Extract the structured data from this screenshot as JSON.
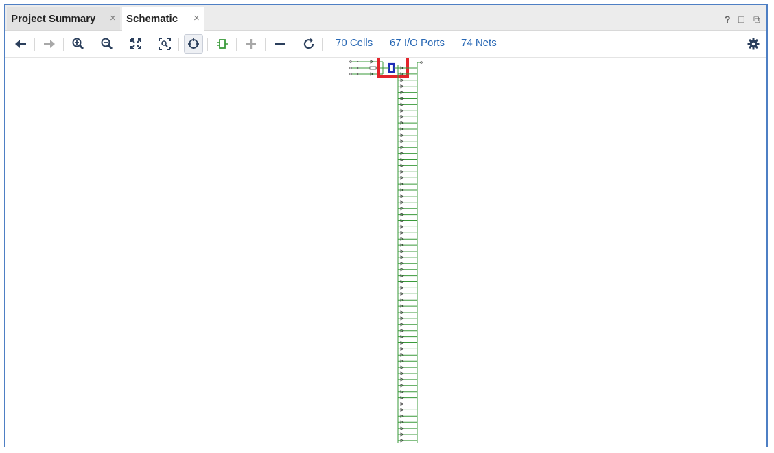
{
  "tabs": [
    {
      "label": "Project Summary",
      "active": false
    },
    {
      "label": "Schematic",
      "active": true
    }
  ],
  "tab_close_glyph": "×",
  "window_controls": {
    "help": "?",
    "maximize": "□",
    "float": "⧉"
  },
  "toolbar": {
    "icons": [
      "back-arrow-icon",
      "forward-arrow-icon",
      "zoom-in-icon",
      "zoom-out-icon",
      "zoom-fit-icon",
      "zoom-area-icon",
      "select-crosshair-icon",
      "cell-icon",
      "expand-plus-icon",
      "collapse-minus-icon",
      "refresh-icon",
      "settings-gear-icon"
    ],
    "stats": {
      "cells": "70 Cells",
      "ports": "67 I/O Ports",
      "nets": "74 Nets"
    }
  },
  "schematic": {
    "output_port_rows": 62,
    "input_port_rows": 3,
    "highlight_color": "#e3242b",
    "wire_color": "#3a9a3a",
    "cell_color": "#1e2db8"
  },
  "colors": {
    "frame": "#4e7fc4",
    "link": "#2767b4",
    "icon": "#2b3f5c"
  }
}
